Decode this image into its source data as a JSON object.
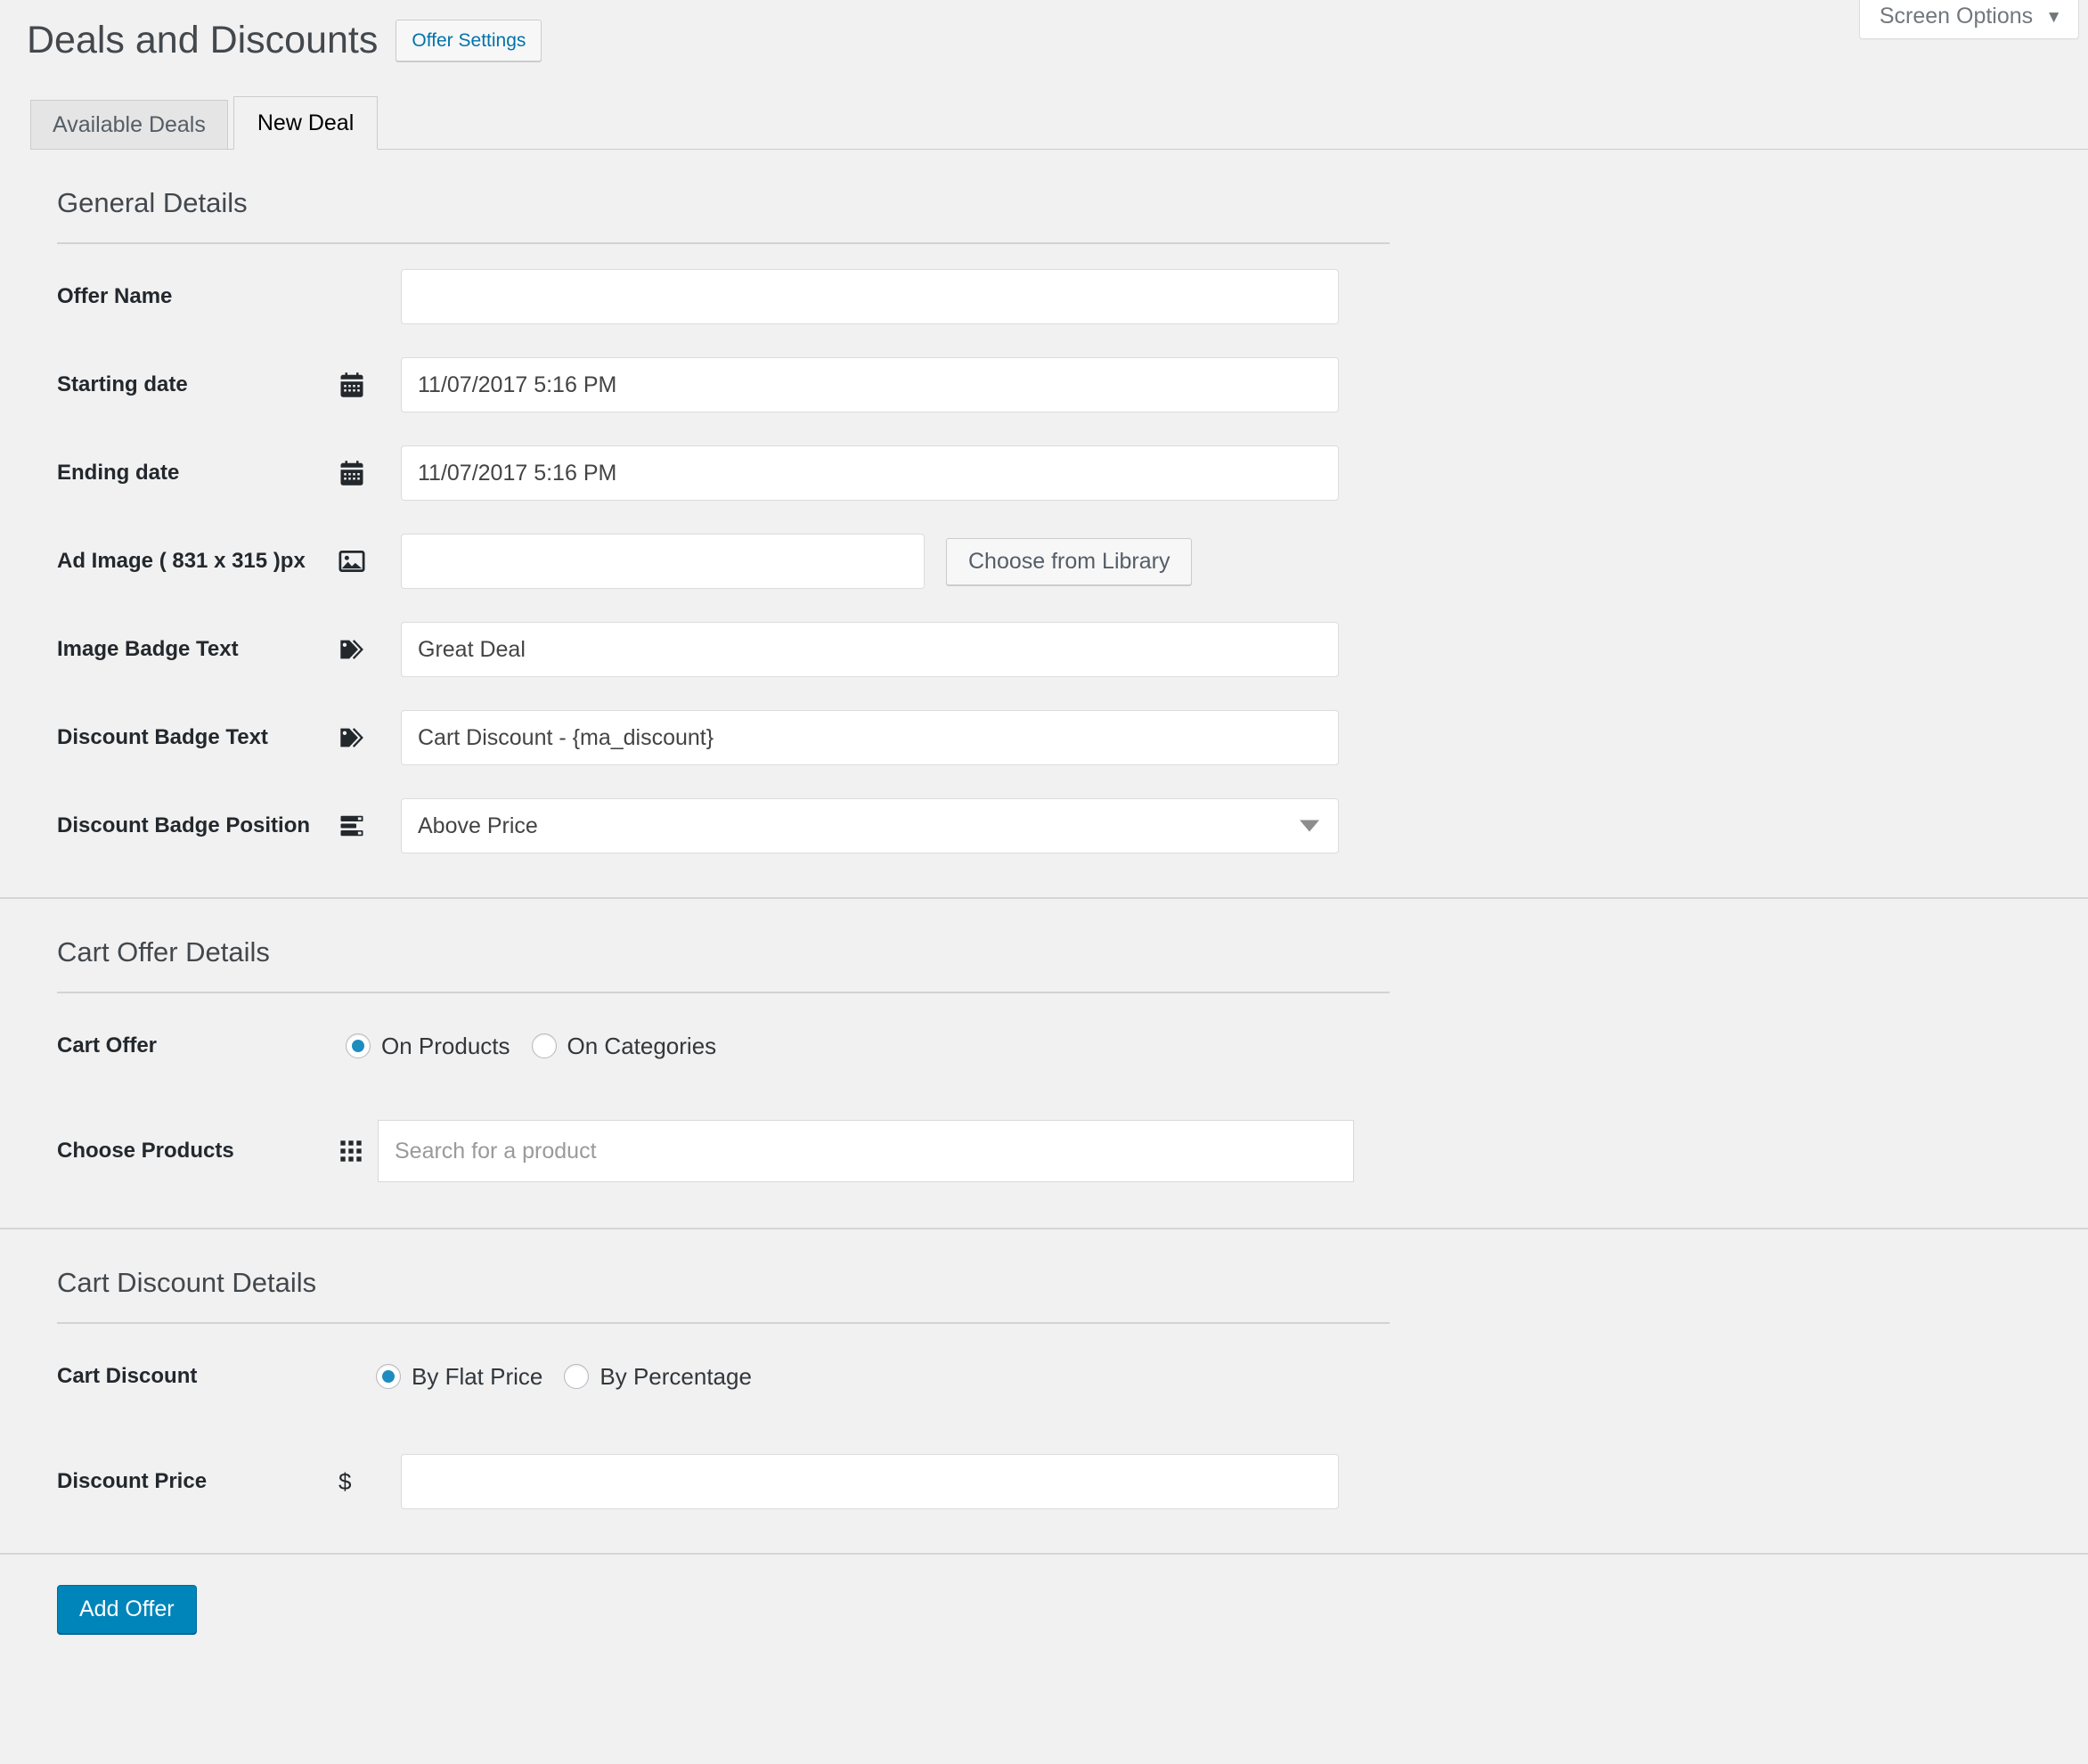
{
  "screen_options": {
    "label": "Screen Options",
    "caret": "chevron-down-icon"
  },
  "header": {
    "title": "Deals and Discounts",
    "offer_settings_label": "Offer Settings"
  },
  "tabs": [
    {
      "label": "Available Deals",
      "active": false
    },
    {
      "label": "New Deal",
      "active": true
    }
  ],
  "sections": {
    "general": {
      "heading": "General Details",
      "offer_name": {
        "label": "Offer Name",
        "value": "",
        "placeholder": ""
      },
      "starting_date": {
        "label": "Starting date",
        "icon": "calendar-icon",
        "value": "11/07/2017 5:16 PM"
      },
      "ending_date": {
        "label": "Ending date",
        "icon": "calendar-icon",
        "value": "11/07/2017 5:16 PM"
      },
      "ad_image": {
        "label": "Ad Image ( 831 x 315 )px",
        "icon": "image-icon",
        "value": "",
        "button_label": "Choose from Library"
      },
      "image_badge_text": {
        "label": "Image Badge Text",
        "icon": "tag-icon",
        "value": "Great Deal"
      },
      "discount_badge_text": {
        "label": "Discount Badge Text",
        "icon": "tag-icon",
        "value": "Cart Discount - {ma_discount}"
      },
      "discount_badge_position": {
        "label": "Discount Badge Position",
        "icon": "list-icon",
        "value": "Above Price"
      }
    },
    "cart_offer": {
      "heading": "Cart Offer Details",
      "cart_offer": {
        "label": "Cart Offer",
        "options": [
          {
            "label": "On Products",
            "selected": true
          },
          {
            "label": "On Categories",
            "selected": false
          }
        ]
      },
      "choose_products": {
        "label": "Choose Products",
        "icon": "grid-icon",
        "value": "",
        "placeholder": "Search for a product"
      }
    },
    "cart_discount": {
      "heading": "Cart Discount Details",
      "cart_discount": {
        "label": "Cart Discount",
        "options": [
          {
            "label": "By Flat Price",
            "selected": true
          },
          {
            "label": "By Percentage",
            "selected": false
          }
        ]
      },
      "discount_price": {
        "label": "Discount Price",
        "icon": "dollar-icon",
        "currency_symbol": "$",
        "value": "",
        "placeholder": ""
      }
    }
  },
  "submit": {
    "label": "Add Offer"
  },
  "colors": {
    "accent": "#0085ba",
    "link": "#0073aa",
    "radio_selected": "#1e8cbe",
    "page_background": "#f1f1f1",
    "divider": "#d5d5d5"
  }
}
